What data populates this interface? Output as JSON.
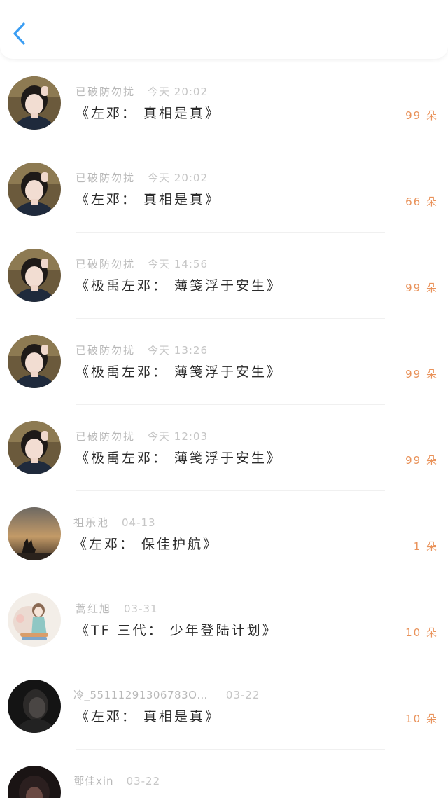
{
  "header": {
    "back_icon": "chevron-left-icon",
    "accent": "#3a9df3"
  },
  "colors": {
    "count": "#e9925a",
    "meta": "#b8b8b8",
    "title": "#2b2b2b"
  },
  "items": [
    {
      "name": "已破防勿扰",
      "time": "今天 20:02",
      "title": "《左邓： 真相是真》",
      "count": "99 朵",
      "avatar": "girl-portrait"
    },
    {
      "name": "已破防勿扰",
      "time": "今天 20:02",
      "title": "《左邓： 真相是真》",
      "count": "66 朵",
      "avatar": "girl-portrait"
    },
    {
      "name": "已破防勿扰",
      "time": "今天 14:56",
      "title": "《极禹左邓： 薄笺浮于安生》",
      "count": "99 朵",
      "avatar": "girl-portrait"
    },
    {
      "name": "已破防勿扰",
      "time": "今天 13:26",
      "title": "《极禹左邓： 薄笺浮于安生》",
      "count": "99 朵",
      "avatar": "girl-portrait"
    },
    {
      "name": "已破防勿扰",
      "time": "今天 12:03",
      "title": "《极禹左邓： 薄笺浮于安生》",
      "count": "99 朵",
      "avatar": "girl-portrait"
    },
    {
      "name": "祖乐池",
      "time": "04-13",
      "title": "《左邓： 保佳护航》",
      "count": "1 朵",
      "avatar": "sunset-hand"
    },
    {
      "name": "蒿红旭",
      "time": "03-31",
      "title": "《TF 三代： 少年登陆计划》",
      "count": "10 朵",
      "avatar": "illustrated-girl"
    },
    {
      "name": "冷_55111291306783O…",
      "time": "03-22",
      "title": "《左邓： 真相是真》",
      "count": "10 朵",
      "avatar": "dark-portrait"
    },
    {
      "name": "鄧佳xin",
      "time": "03-22",
      "title": "",
      "count": "",
      "avatar": "dark-portrait-2"
    }
  ]
}
